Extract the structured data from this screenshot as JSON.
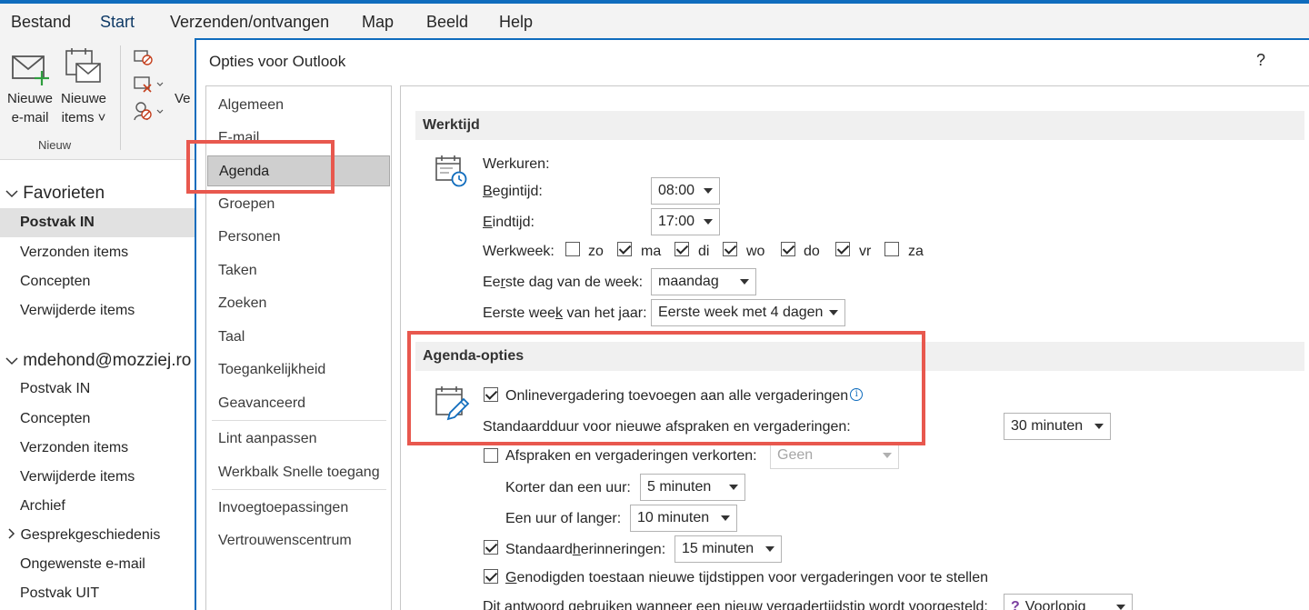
{
  "menu": {
    "file": "Bestand",
    "home": "Start",
    "send_receive": "Verzenden/ontvangen",
    "folder": "Map",
    "view": "Beeld",
    "help": "Help"
  },
  "ribbon": {
    "new_email": [
      "Nieuwe",
      "e-mail"
    ],
    "new_items": [
      "Nieuwe",
      "items ˅"
    ],
    "group_new": "Nieuw",
    "clipped_label": "Ve"
  },
  "nav": {
    "favorites_header": "Favorieten",
    "favorites": [
      "Postvak IN",
      "Verzonden items",
      "Concepten",
      "Verwijderde items"
    ],
    "account_header": "mdehond@mozziej.ro",
    "account_items": [
      "Postvak IN",
      "Concepten",
      "Verzonden items",
      "Verwijderde items",
      "Archief",
      "Gesprekgeschiedenis",
      "Ongewenste e-mail",
      "Postvak UIT"
    ]
  },
  "dialog": {
    "title": "Opties voor Outlook",
    "help": "?",
    "categories": [
      "Algemeen",
      "E-mail",
      "Agenda",
      "Groepen",
      "Personen",
      "Taken",
      "Zoeken",
      "Taal",
      "Toegankelijkheid",
      "Geavanceerd",
      "Lint aanpassen",
      "Werkbalk Snelle toegang",
      "Invoegtoepassingen",
      "Vertrouwenscentrum"
    ],
    "selected_category": "Agenda"
  },
  "werktijd": {
    "header": "Werktijd",
    "hours_label": "Werkuren:",
    "start_label_u": "B",
    "start_label_rest": "egintijd:",
    "start_value": "08:00",
    "end_label_u": "E",
    "end_label_rest": "indtijd:",
    "end_value": "17:00",
    "week_label": "Werkweek:",
    "days": [
      {
        "label": "zo",
        "checked": false
      },
      {
        "label": "ma",
        "checked": true
      },
      {
        "label": "di",
        "checked": true
      },
      {
        "label": "wo",
        "checked": true
      },
      {
        "label": "do",
        "checked": true
      },
      {
        "label": "vr",
        "checked": true
      },
      {
        "label": "za",
        "checked": false
      }
    ],
    "first_day_label_a": "Ee",
    "first_day_label_u": "r",
    "first_day_label_b": "ste dag van de week:",
    "first_day_value": "maandag",
    "first_week_label_a": "Eerste wee",
    "first_week_label_u": "k",
    "first_week_label_b": " van het jaar:",
    "first_week_value": "Eerste week met 4 dagen"
  },
  "agenda_opties": {
    "header": "Agenda-opties",
    "online_meeting": "Onlinevergadering toevoegen aan alle vergaderingen",
    "online_meeting_checked": true,
    "info_glyph": "i",
    "default_duration_label": "Standaardduur voor nieuwe afspraken en vergaderingen:",
    "default_duration_value": "30 minuten",
    "shorten_label": "Afspraken en vergaderingen verkorten:",
    "shorten_checked": false,
    "shorten_value": "Geen",
    "shorter_hour_label": "Korter dan een uur:",
    "shorter_hour_value": "5 minuten",
    "hour_longer_label": "Een uur of langer:",
    "hour_longer_value": "10 minuten",
    "reminders_label_a": "Standaard",
    "reminders_label_u": "h",
    "reminders_label_b": "erinneringen:",
    "reminders_checked": true,
    "reminders_value": "15 minuten",
    "allow_new_times_u": "G",
    "allow_new_times_rest": "enodigden toestaan nieuwe tijdstippen voor vergaderingen voor te stellen",
    "allow_new_times_checked": true,
    "response_label": "Dit antwoord gebruiken wanneer een nieuw vergadertijdstip wordt voorgesteld:",
    "response_value": "Voorlopig"
  },
  "colors": {
    "accent": "#0f6cbd",
    "highlight_box": "#e8584e",
    "section_bg": "#f0f0f0",
    "selected_category_bg": "#cfcfcf"
  }
}
